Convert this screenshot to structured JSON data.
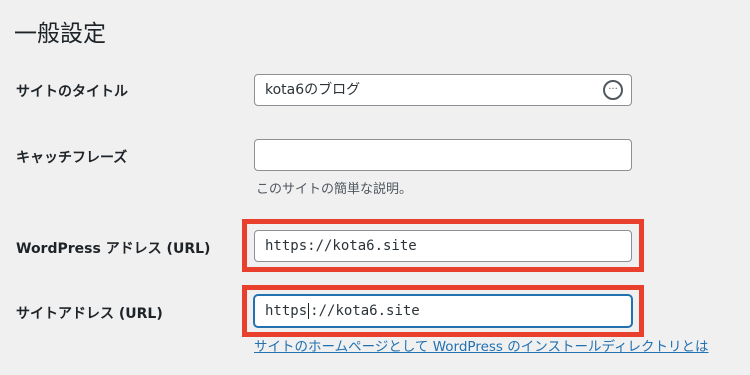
{
  "page": {
    "title": "一般設定"
  },
  "fields": {
    "site_title": {
      "label": "サイトのタイトル",
      "value": "kota6のブログ"
    },
    "tagline": {
      "label": "キャッチフレーズ",
      "value": "",
      "description": "このサイトの簡単な説明。"
    },
    "wp_address": {
      "label": "WordPress アドレス (URL)",
      "value": "https://kota6.site"
    },
    "site_address": {
      "label": "サイトアドレス (URL)",
      "value_before_cursor": "https",
      "value_after_cursor": "://kota6.site",
      "help_link": "サイトのホームページとして WordPress のインストールディレクトリとは"
    }
  },
  "icons": {
    "site_title_extension": "ellipsis-circle-icon"
  },
  "colors": {
    "highlight": "#e8402c",
    "link": "#2271b1",
    "focus": "#2271b1"
  }
}
